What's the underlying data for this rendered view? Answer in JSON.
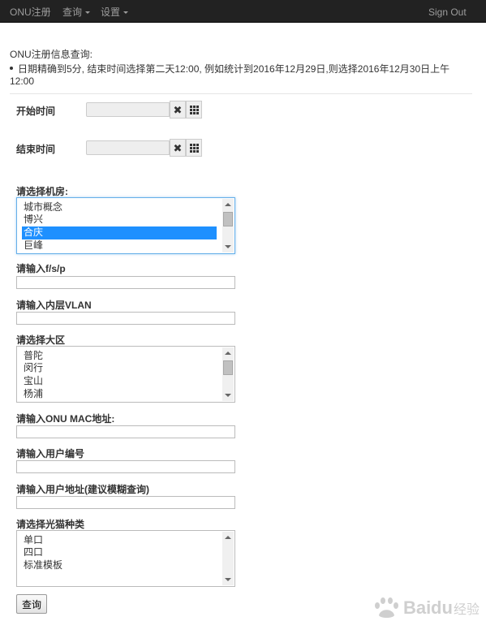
{
  "navbar": {
    "brand": "ONU注册",
    "menu_query": "查询",
    "menu_settings": "设置",
    "sign_out": "Sign Out"
  },
  "page": {
    "heading": "ONU注册信息查询:",
    "note": "日期精确到5分, 结束时间选择第二天12:00, 例如统计到2016年12月29日,则选择2016年12月30日上午12:00"
  },
  "form": {
    "start_time_label": "开始时间",
    "start_time_value": "",
    "end_time_label": "结束时间",
    "end_time_value": "",
    "room_label": "请选择机房:",
    "room_options": [
      "城市概念",
      "博兴",
      "合庆",
      "巨峰"
    ],
    "room_selected": "合庆",
    "fsp_label": "请输入f/s/p",
    "fsp_value": "",
    "vlan_label": "请输入内层VLAN",
    "vlan_value": "",
    "region_label": "请选择大区",
    "region_options": [
      "普陀",
      "闵行",
      "宝山",
      "杨浦"
    ],
    "mac_label": "请输入ONU MAC地址:",
    "mac_value": "",
    "user_no_label": "请输入用户编号",
    "user_no_value": "",
    "address_label": "请输入用户地址(建议模糊查询)",
    "address_value": "",
    "modem_label": "请选择光猫种类",
    "modem_options": [
      "单口",
      "四口",
      "标准模板"
    ],
    "submit_label": "查询"
  },
  "watermark": {
    "text_latin": "Bai",
    "text_suffix": "du",
    "text_cn": "经验"
  },
  "colors": {
    "navbar_bg": "#222222",
    "navbar_text": "#9d9d9d",
    "selection": "#1e90ff",
    "focus_border": "#66afe9"
  }
}
